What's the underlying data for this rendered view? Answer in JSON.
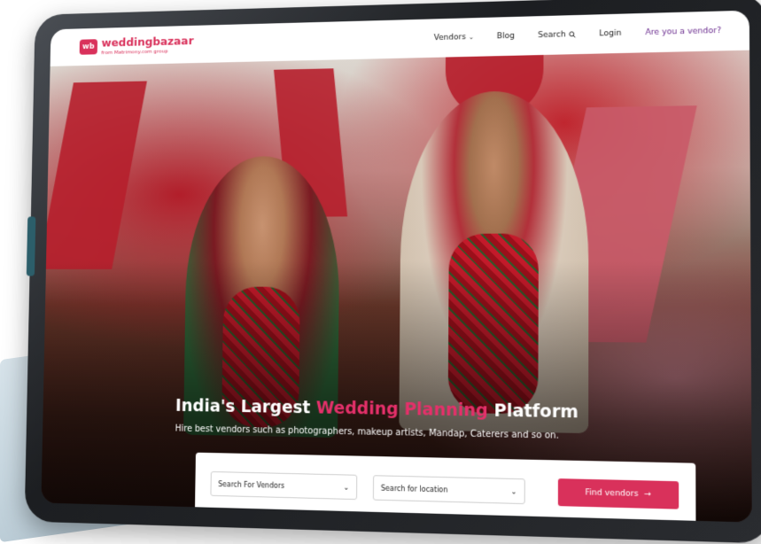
{
  "brand": {
    "logo_mark": "wb",
    "wordmark": "weddingbazaar",
    "tagline": "from Matrimony.com group"
  },
  "nav": {
    "items": [
      {
        "label": "Vendors",
        "has_dropdown": true
      },
      {
        "label": "Blog"
      },
      {
        "label": "Search",
        "icon": "search-icon"
      },
      {
        "label": "Login"
      },
      {
        "label": "Are you a vendor?"
      }
    ]
  },
  "hero": {
    "headline_prefix": "India's Largest ",
    "headline_accent": "Wedding Planning",
    "headline_suffix": " Platform",
    "subheadline": "Hire best vendors such as photographers, makeup artists, Mandap, Caterers and so on."
  },
  "search": {
    "vendor_select": "Search For Vendors",
    "location_select": "Search for location",
    "button_label": "Find vendors",
    "button_arrow": "→"
  },
  "colors": {
    "brand": "#d9315b",
    "vendor_cta": "#6b2d8f"
  }
}
